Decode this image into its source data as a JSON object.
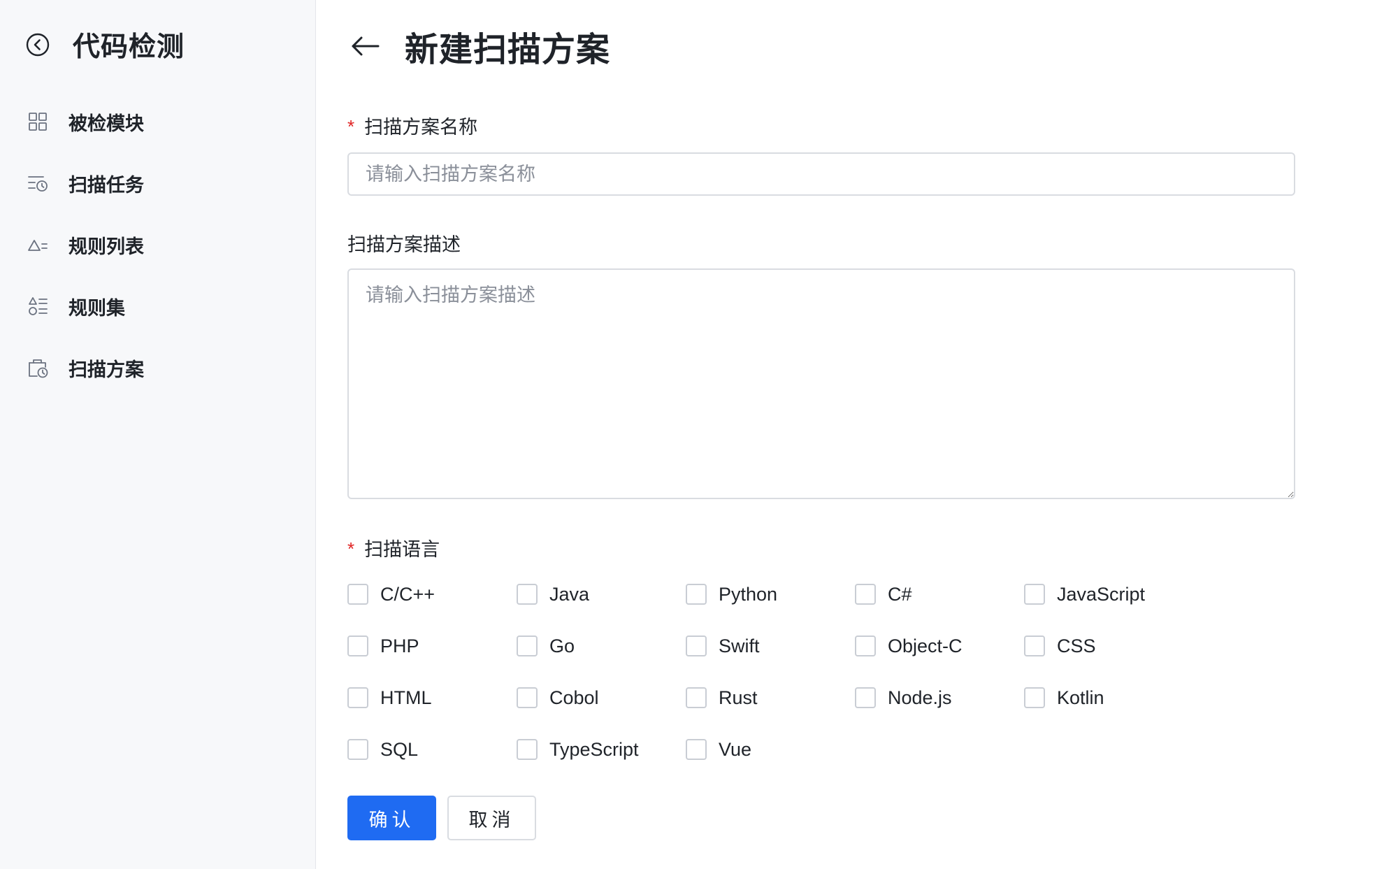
{
  "sidebar": {
    "title": "代码检测",
    "items": [
      {
        "label": "被检模块",
        "icon": "grid-icon"
      },
      {
        "label": "扫描任务",
        "icon": "task-clock-icon"
      },
      {
        "label": "规则列表",
        "icon": "rule-list-icon"
      },
      {
        "label": "规则集",
        "icon": "rule-set-icon"
      },
      {
        "label": "扫描方案",
        "icon": "scan-plan-icon"
      }
    ]
  },
  "page": {
    "title": "新建扫描方案"
  },
  "form": {
    "name_label": "扫描方案名称",
    "name_placeholder": "请输入扫描方案名称",
    "name_value": "",
    "desc_label": "扫描方案描述",
    "desc_placeholder": "请输入扫描方案描述",
    "desc_value": "",
    "lang_label": "扫描语言",
    "required_mark": "*",
    "languages": [
      {
        "label": "C/C++",
        "checked": false
      },
      {
        "label": "Java",
        "checked": false
      },
      {
        "label": "Python",
        "checked": false
      },
      {
        "label": "C#",
        "checked": false
      },
      {
        "label": "JavaScript",
        "checked": false
      },
      {
        "label": "PHP",
        "checked": false
      },
      {
        "label": "Go",
        "checked": false
      },
      {
        "label": "Swift",
        "checked": false
      },
      {
        "label": "Object-C",
        "checked": false
      },
      {
        "label": "CSS",
        "checked": false
      },
      {
        "label": "HTML",
        "checked": false
      },
      {
        "label": "Cobol",
        "checked": false
      },
      {
        "label": "Rust",
        "checked": false
      },
      {
        "label": "Node.js",
        "checked": false
      },
      {
        "label": "Kotlin",
        "checked": false
      },
      {
        "label": "SQL",
        "checked": false
      },
      {
        "label": "TypeScript",
        "checked": false
      },
      {
        "label": "Vue",
        "checked": false
      }
    ]
  },
  "actions": {
    "confirm_label": "确认",
    "cancel_label": "取消"
  },
  "colors": {
    "primary": "#1f6bf2",
    "required": "#e02424",
    "sidebar_bg": "#f7f8fa"
  }
}
